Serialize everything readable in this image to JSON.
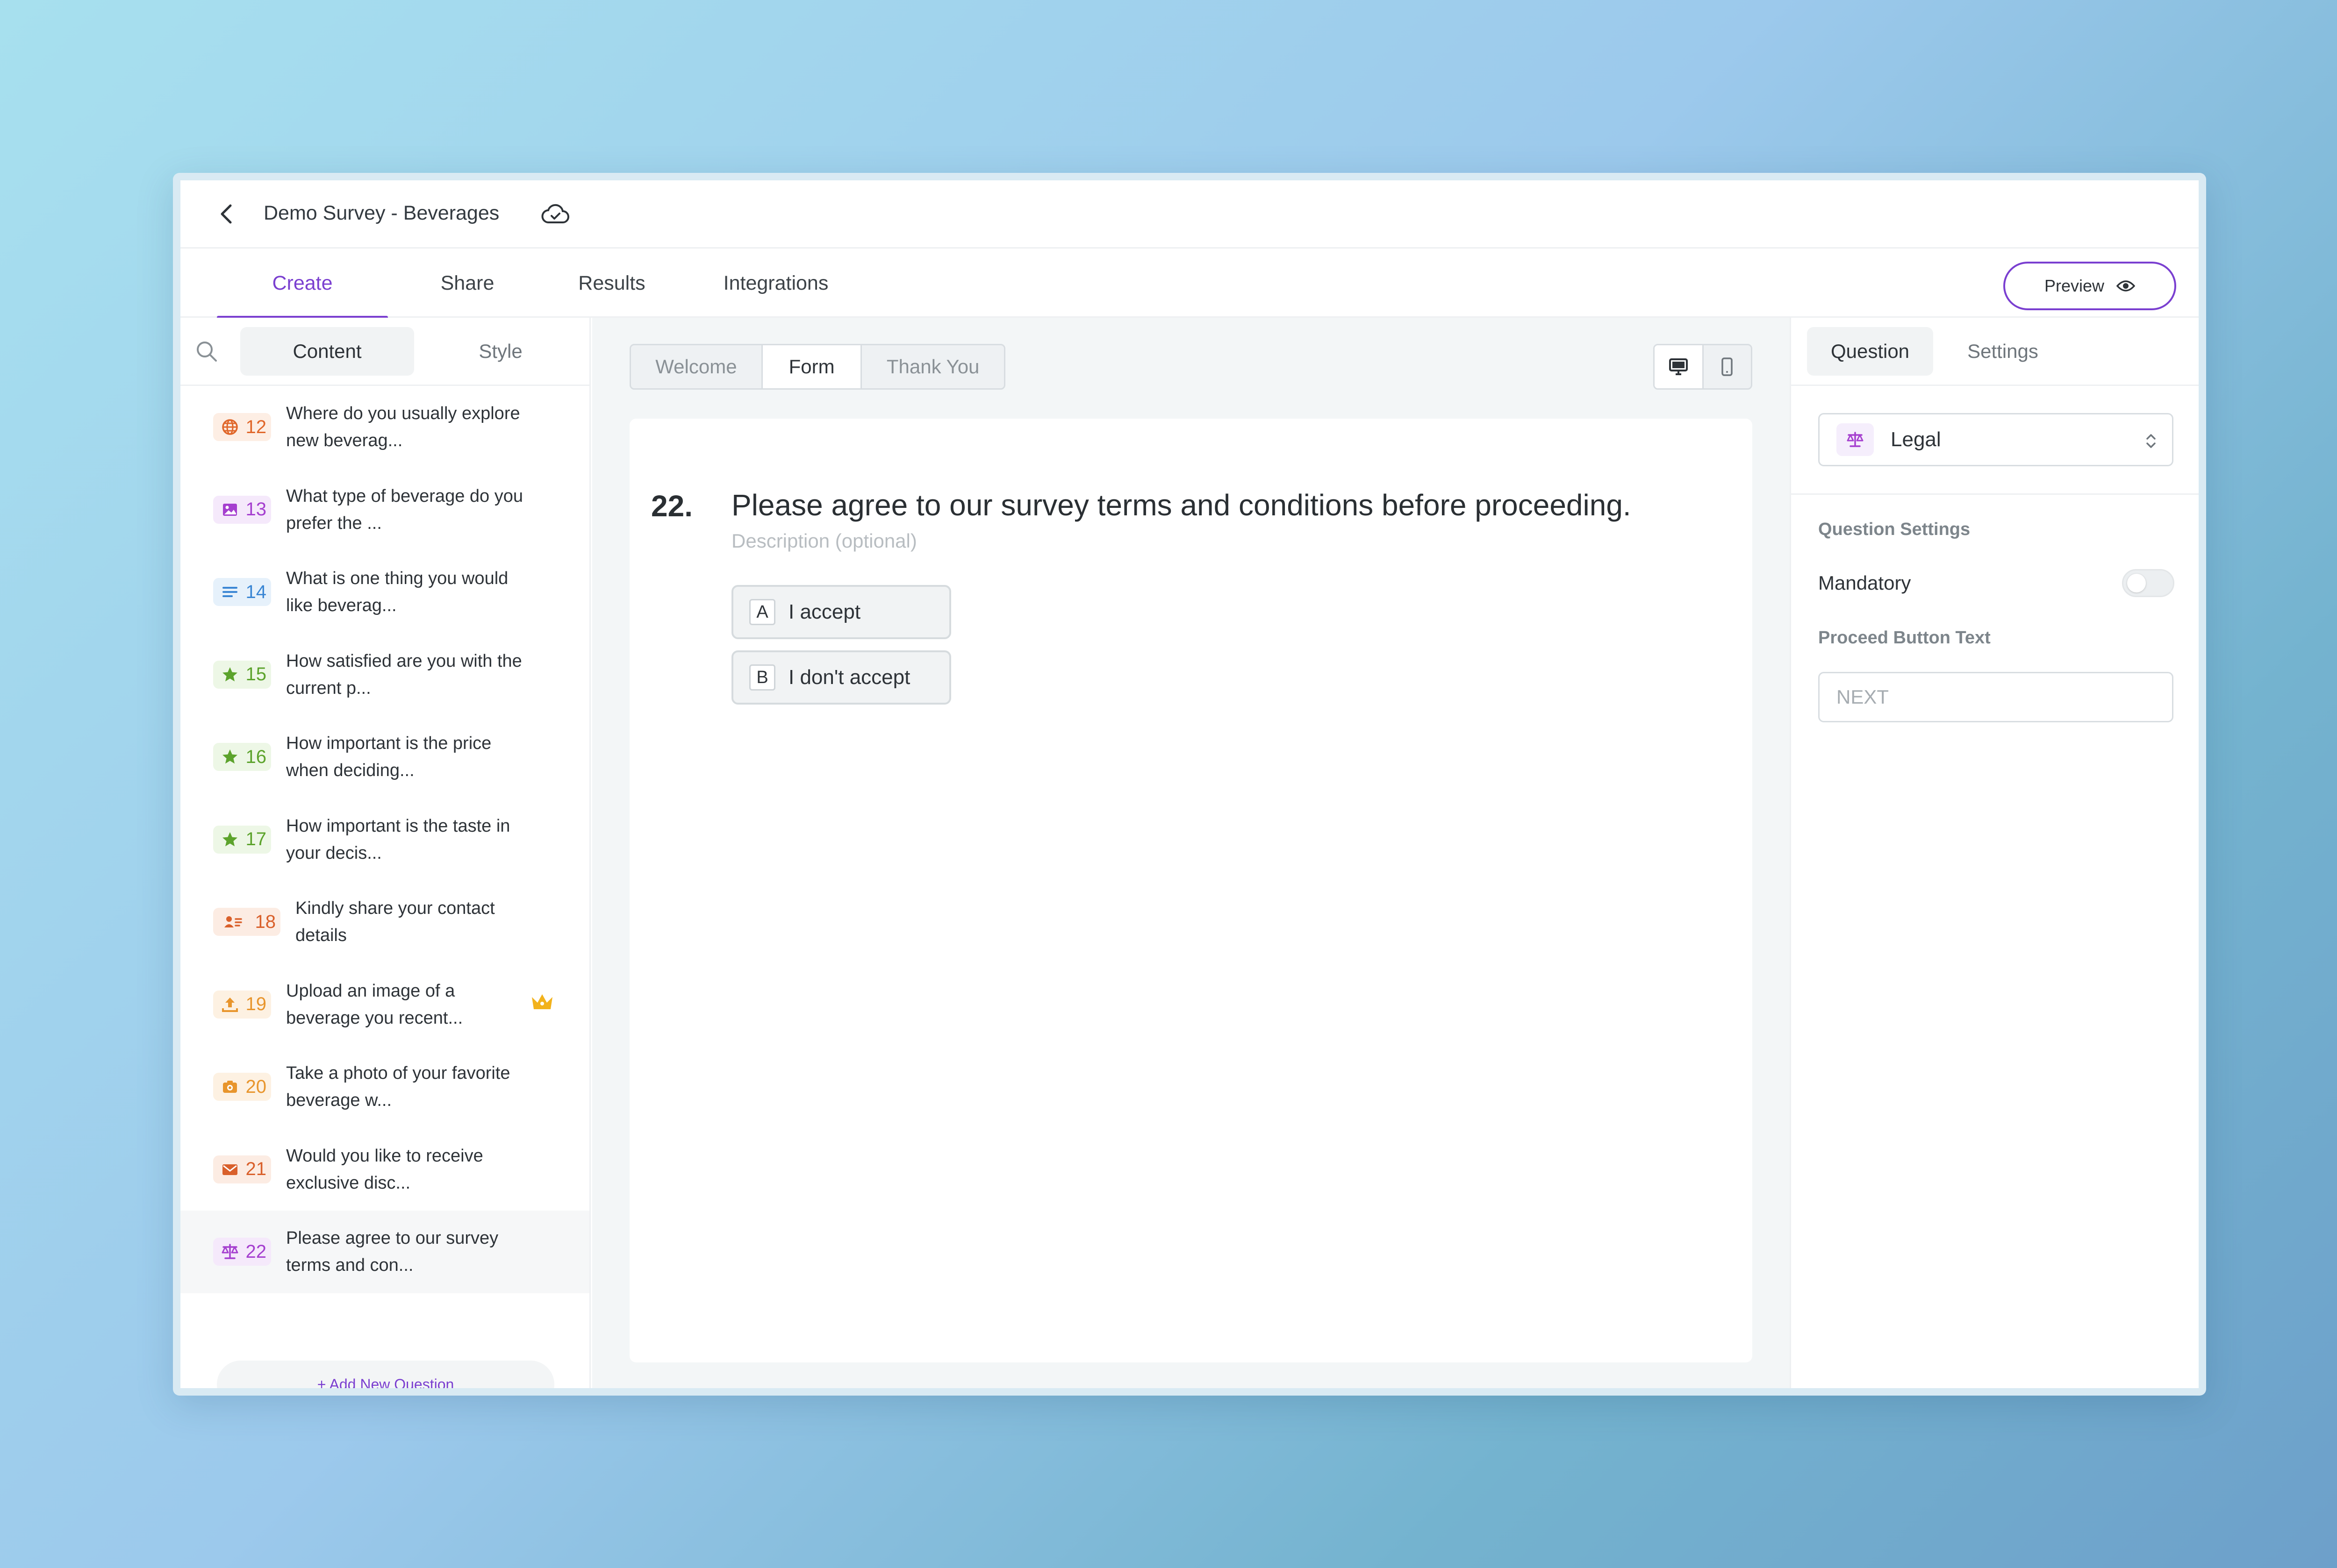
{
  "header": {
    "survey_title": "Demo Survey - Beverages"
  },
  "main_tabs": [
    {
      "label": "Create",
      "active": true
    },
    {
      "label": "Share",
      "active": false
    },
    {
      "label": "Results",
      "active": false
    },
    {
      "label": "Integrations",
      "active": false
    }
  ],
  "preview_label": "Preview",
  "left_panel": {
    "tabs": [
      {
        "label": "Content",
        "active": true
      },
      {
        "label": "Style",
        "active": false
      }
    ],
    "questions": [
      {
        "num": "12",
        "text": "Where do you usually explore new beverag...",
        "icon": "globe-icon",
        "color": "#e0672a",
        "bg": "#fdeee4"
      },
      {
        "num": "13",
        "text": "What type of beverage do you prefer the ...",
        "icon": "image-icon",
        "color": "#a53fcf",
        "bg": "#f5e9fb"
      },
      {
        "num": "14",
        "text": "What is one thing you would like beverag...",
        "icon": "text-lines-icon",
        "color": "#3a86d4",
        "bg": "#e6f1fb"
      },
      {
        "num": "15",
        "text": "How satisfied are you with the current p...",
        "icon": "star-icon",
        "color": "#5ca32c",
        "bg": "#edf7e6"
      },
      {
        "num": "16",
        "text": "How important is the price when deciding...",
        "icon": "star-icon",
        "color": "#5ca32c",
        "bg": "#edf7e6"
      },
      {
        "num": "17",
        "text": "How important is the taste in your decis...",
        "icon": "star-icon",
        "color": "#5ca32c",
        "bg": "#edf7e6"
      },
      {
        "num": "18",
        "text": "Kindly share your contact details",
        "icon": "contact-card-icon",
        "color": "#d9602b",
        "bg": "#fcece3"
      },
      {
        "num": "19",
        "text": "Upload an image of a beverage you recent...",
        "icon": "upload-icon",
        "color": "#e8952c",
        "bg": "#fdf1e2",
        "premium": true
      },
      {
        "num": "20",
        "text": "Take a photo of your favorite beverage w...",
        "icon": "camera-icon",
        "color": "#e8952c",
        "bg": "#fdf1e2"
      },
      {
        "num": "21",
        "text": "Would you like to receive exclusive disc...",
        "icon": "envelope-icon",
        "color": "#d9602b",
        "bg": "#fcece3"
      },
      {
        "num": "22",
        "text": "Please agree to our survey terms and con...",
        "icon": "scales-icon",
        "color": "#a53fcf",
        "bg": "#f5e9fb",
        "selected": true
      }
    ],
    "add_question_label": "+ Add New Question"
  },
  "center": {
    "steps": [
      {
        "label": "Welcome",
        "active": false
      },
      {
        "label": "Form",
        "active": true
      },
      {
        "label": "Thank You",
        "active": false
      }
    ],
    "question": {
      "number": "22.",
      "title": "Please agree to our survey terms and conditions before proceeding.",
      "description_placeholder": "Description (optional)",
      "options": [
        {
          "key": "A",
          "label": "I accept"
        },
        {
          "key": "B",
          "label": "I don't accept"
        }
      ]
    }
  },
  "right_panel": {
    "tabs": [
      {
        "label": "Question",
        "active": true
      },
      {
        "label": "Settings",
        "active": false
      }
    ],
    "question_type": "Legal",
    "question_settings_label": "Question Settings",
    "mandatory_label": "Mandatory",
    "mandatory_on": false,
    "proceed_label": "Proceed Button Text",
    "proceed_placeholder": "NEXT",
    "proceed_value": ""
  },
  "colors": {
    "accent": "#7a3fd0",
    "premium": "#f2b21c"
  }
}
